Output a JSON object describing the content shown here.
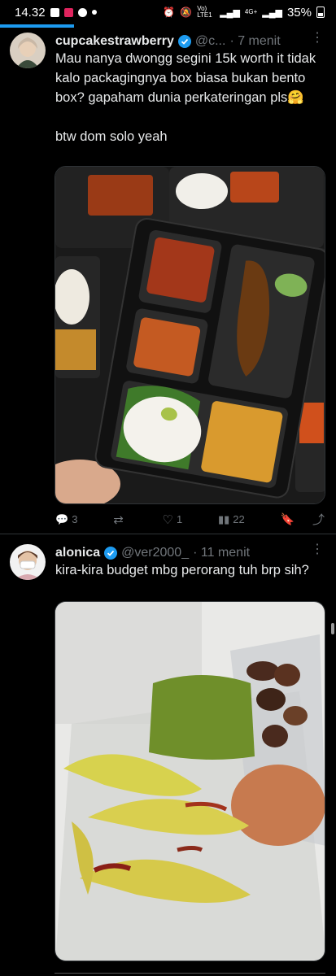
{
  "status_bar": {
    "time": "14.32",
    "network": "Vo) LTE1",
    "net2": "4G+",
    "battery": "35%"
  },
  "tweets": [
    {
      "display_name": "cupcakestrawberry",
      "handle": "@c...",
      "time": "· 7 menit",
      "text": "Mau nanya dwongg segini 15k worth it tidak kalo packagingnya box biasa bukan bento box? gapaham dunia perkateringan pls🤗\n\nbtw dom solo yeah",
      "media_desc": "food-photo-bento-rice-boxes",
      "replies": "3",
      "reposts": "",
      "likes": "1",
      "views": "22"
    },
    {
      "display_name": "alonica",
      "handle": "@ver2000_",
      "time": "· 11 menit",
      "text": "kira-kira budget mbg perorang tuh brp sih?",
      "media_desc": "food-photo-bananas-egg-cake"
    }
  ],
  "colors": {
    "accent": "#1d9bf0",
    "muted": "#71767b",
    "divider": "#2f3336"
  }
}
